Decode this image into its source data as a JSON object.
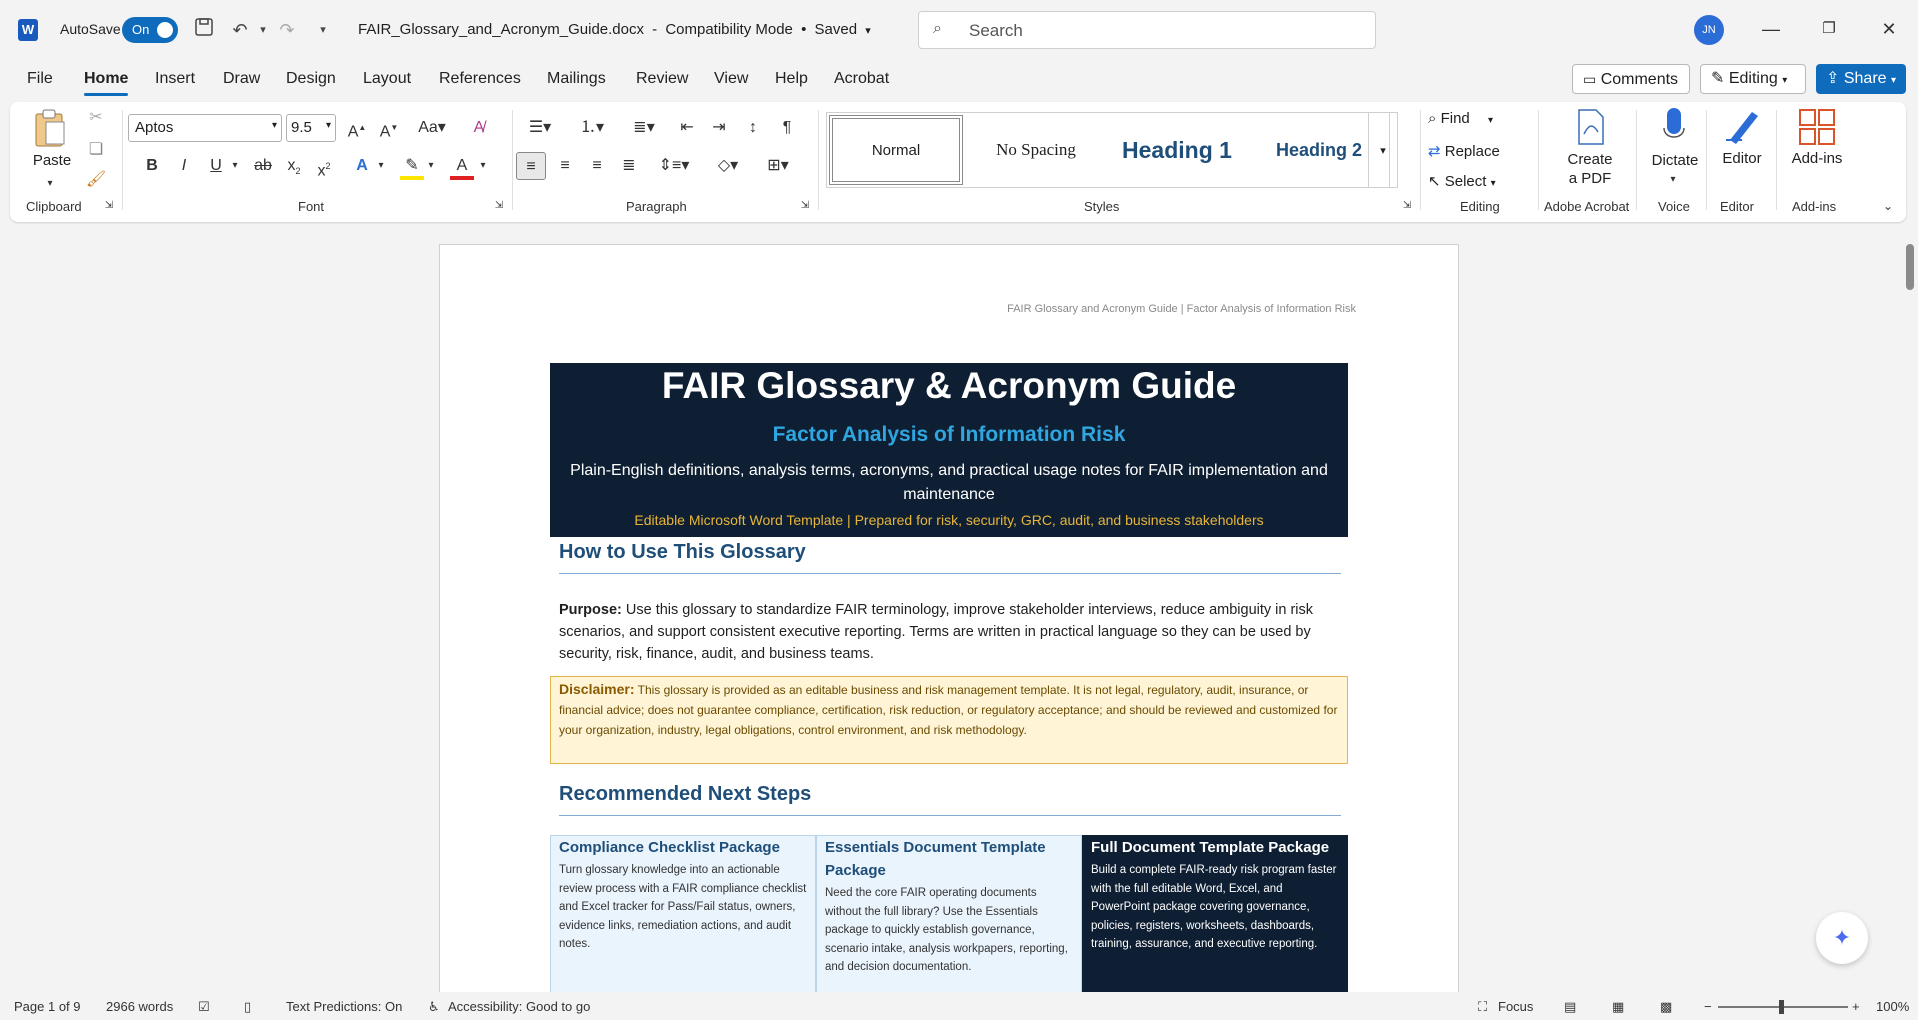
{
  "titlebar": {
    "autosave_label": "AutoSave",
    "autosave_state": "On",
    "doc_title": "FAIR_Glossary_and_Acronym_Guide.docx",
    "mode": "Compatibility Mode",
    "save_status": "Saved",
    "search_placeholder": "Search",
    "avatar_initials": "JN"
  },
  "menu": {
    "tabs": [
      "File",
      "Home",
      "Insert",
      "Draw",
      "Design",
      "Layout",
      "References",
      "Mailings",
      "Review",
      "View",
      "Help",
      "Acrobat"
    ],
    "active_tab": "Home",
    "comments_label": "Comments",
    "editing_label": "Editing",
    "share_label": "Share"
  },
  "ribbon": {
    "paste_label": "Paste",
    "font_name": "Aptos",
    "font_size": "9.5",
    "styles": [
      "Normal",
      "No Spacing",
      "Heading 1",
      "Heading 2"
    ],
    "find_label": "Find",
    "replace_label": "Replace",
    "select_label": "Select",
    "create_pdf_label_1": "Create",
    "create_pdf_label_2": "a PDF",
    "dictate_label": "Dictate",
    "editor_label": "Editor",
    "addins_label": "Add-ins",
    "groups": [
      "Clipboard",
      "Font",
      "Paragraph",
      "Styles",
      "Editing",
      "Adobe Acrobat",
      "Voice",
      "Editor",
      "Add-ins"
    ],
    "accent_color": "#0f6cbd"
  },
  "document": {
    "running_header": "FAIR Glossary and Acronym Guide | Factor Analysis of Information Risk",
    "banner": {
      "title": "FAIR Glossary & Acronym Guide",
      "subtitle": "Factor Analysis of Information Risk",
      "description": "Plain-English definitions, analysis terms, acronyms, and practical usage notes for FAIR implementation and maintenance",
      "note": "Editable Microsoft Word Template | Prepared for risk, security, GRC, audit, and business stakeholders"
    },
    "section1_heading": "How to Use This Glossary",
    "purpose_label": "Purpose:",
    "purpose_text": "Use this glossary to standardize FAIR terminology, improve stakeholder interviews, reduce ambiguity in risk scenarios, and support consistent executive reporting. Terms are written in practical language so they can be used by security, risk, finance, audit, and business teams.",
    "disclaimer_label": "Disclaimer:",
    "disclaimer_text": "This glossary is provided as an editable business and risk management template. It is not legal, regulatory, audit, insurance, or financial advice; does not guarantee compliance, certification, risk reduction, or regulatory acceptance; and should be reviewed and customized for your organization, industry, legal obligations, control environment, and risk methodology.",
    "section2_heading": "Recommended Next Steps",
    "cards": [
      {
        "title": "Compliance Checklist Package",
        "body": "Turn glossary knowledge into an actionable review process with a FAIR compliance checklist and Excel tracker for Pass/Fail status, owners, evidence links, remediation actions, and audit notes."
      },
      {
        "title": "Essentials Document Template Package",
        "body": "Need the core FAIR operating documents without the full library? Use the Essentials package to quickly establish governance, scenario intake, analysis workpapers, reporting, and decision documentation."
      },
      {
        "title": "Full Document Template Package",
        "body": "Build a complete FAIR-ready risk program faster with the full editable Word, Excel, and PowerPoint package covering governance, policies, registers, worksheets, dashboards, training, assurance, and executive reporting."
      }
    ]
  },
  "statusbar": {
    "page": "Page 1 of 9",
    "words": "2966 words",
    "text_predictions": "Text Predictions: On",
    "accessibility": "Accessibility: Good to go",
    "focus": "Focus",
    "zoom": "100%"
  }
}
